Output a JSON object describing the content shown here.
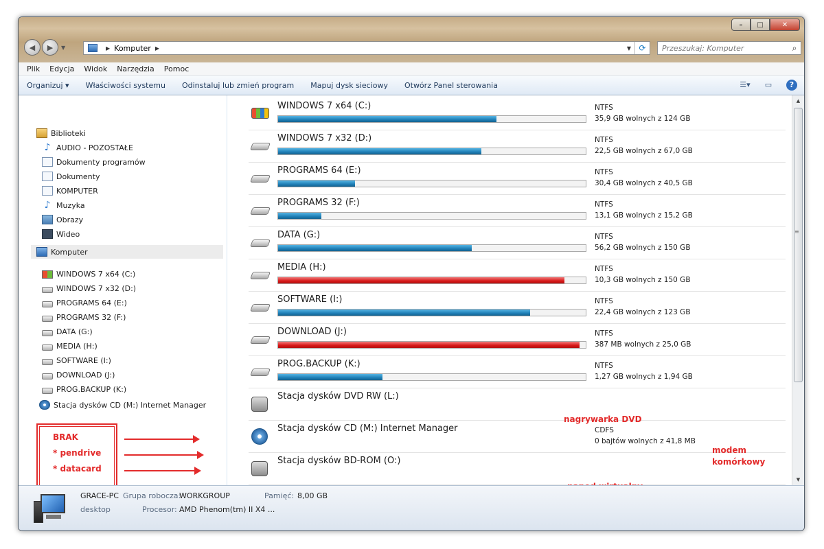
{
  "window": {
    "breadcrumb": "Komputer",
    "search_placeholder": "Przeszukaj: Komputer",
    "controls": {
      "minimize": "–",
      "maximize": "□",
      "close": "✕"
    }
  },
  "menu": [
    "Plik",
    "Edycja",
    "Widok",
    "Narzędzia",
    "Pomoc"
  ],
  "toolbar": {
    "items": [
      "Organizuj ▾",
      "Właściwości systemu",
      "Odinstaluj lub zmień program",
      "Mapuj dysk sieciowy",
      "Otwórz Panel sterowania"
    ]
  },
  "sidebar": {
    "libraries_label": "Biblioteki",
    "libraries": [
      {
        "label": "AUDIO - POZOSTAŁE",
        "icon": "music-icon"
      },
      {
        "label": "Dokumenty programów",
        "icon": "document-icon"
      },
      {
        "label": "Dokumenty",
        "icon": "document-icon"
      },
      {
        "label": "KOMPUTER",
        "icon": "document-icon"
      },
      {
        "label": "Muzyka",
        "icon": "music-icon"
      },
      {
        "label": "Obrazy",
        "icon": "image-icon"
      },
      {
        "label": "Wideo",
        "icon": "video-icon"
      }
    ],
    "computer_label": "Komputer",
    "drives": [
      "WINDOWS 7  x64 (C:)",
      "WINDOWS 7  x32 (D:)",
      "PROGRAMS 64 (E:)",
      "PROGRAMS 32 (F:)",
      "DATA (G:)",
      "MEDIA (H:)",
      "SOFTWARE (I:)",
      "DOWNLOAD (J:)",
      "PROG.BACKUP (K:)",
      "Stacja dysków CD (M:) Internet Manager"
    ],
    "annotation": [
      "BRAK",
      "* pendrive",
      "* datacard"
    ]
  },
  "drives": [
    {
      "name": "WINDOWS 7  x64 (C:)",
      "fs": "NTFS",
      "free": "35,9 GB wolnych z 124 GB",
      "used": 0.71,
      "color": "blue",
      "icon": "windows-drive-icon"
    },
    {
      "name": "WINDOWS 7  x32 (D:)",
      "fs": "NTFS",
      "free": "22,5 GB wolnych z 67,0 GB",
      "used": 0.66,
      "color": "blue",
      "icon": "hard-drive-icon"
    },
    {
      "name": "PROGRAMS 64 (E:)",
      "fs": "NTFS",
      "free": "30,4 GB wolnych z 40,5 GB",
      "used": 0.25,
      "color": "blue",
      "icon": "hard-drive-icon"
    },
    {
      "name": "PROGRAMS 32 (F:)",
      "fs": "NTFS",
      "free": "13,1 GB wolnych z 15,2 GB",
      "used": 0.14,
      "color": "blue",
      "icon": "hard-drive-icon"
    },
    {
      "name": "DATA (G:)",
      "fs": "NTFS",
      "free": "56,2 GB wolnych z 150 GB",
      "used": 0.63,
      "color": "blue",
      "icon": "hard-drive-icon"
    },
    {
      "name": "MEDIA (H:)",
      "fs": "NTFS",
      "free": "10,3 GB wolnych z 150 GB",
      "used": 0.93,
      "color": "red",
      "icon": "hard-drive-icon"
    },
    {
      "name": "SOFTWARE (I:)",
      "fs": "NTFS",
      "free": "22,4 GB wolnych z 123 GB",
      "used": 0.82,
      "color": "blue",
      "icon": "hard-drive-icon"
    },
    {
      "name": "DOWNLOAD (J:)",
      "fs": "NTFS",
      "free": "387 MB wolnych z 25,0 GB",
      "used": 0.98,
      "color": "red",
      "icon": "hard-drive-icon"
    },
    {
      "name": "PROG.BACKUP (K:)",
      "fs": "NTFS",
      "free": "1,27 GB wolnych z 1,94 GB",
      "used": 0.34,
      "color": "blue",
      "icon": "hard-drive-icon"
    },
    {
      "name": "Stacja dysków DVD RW (L:)",
      "fs": "",
      "free": "",
      "used": null,
      "color": "",
      "icon": "dvd-drive-icon"
    },
    {
      "name": "Stacja dysków CD (M:) Internet Manager",
      "fs": "CDFS",
      "free": "0 bajtów wolnych z 41,8 MB",
      "used": null,
      "color": "",
      "icon": "cd-drive-icon"
    },
    {
      "name": "Stacja dysków BD-ROM (O:)",
      "fs": "",
      "free": "",
      "used": null,
      "color": "",
      "icon": "bd-drive-icon"
    }
  ],
  "notes": {
    "dvd": "nagrywarka DVD",
    "modem_1": "modem",
    "modem_2": "komórkowy",
    "virtual": "napęd wirtualny"
  },
  "status": {
    "pc_name": "GRACE-PC",
    "pc_sub": "desktop",
    "workgroup_label": "Grupa robocza:",
    "workgroup_value": "WORKGROUP",
    "memory_label": "Pamięć:",
    "memory_value": "8,00 GB",
    "cpu_label": "Procesor:",
    "cpu_value": "AMD Phenom(tm) II X4 ..."
  }
}
